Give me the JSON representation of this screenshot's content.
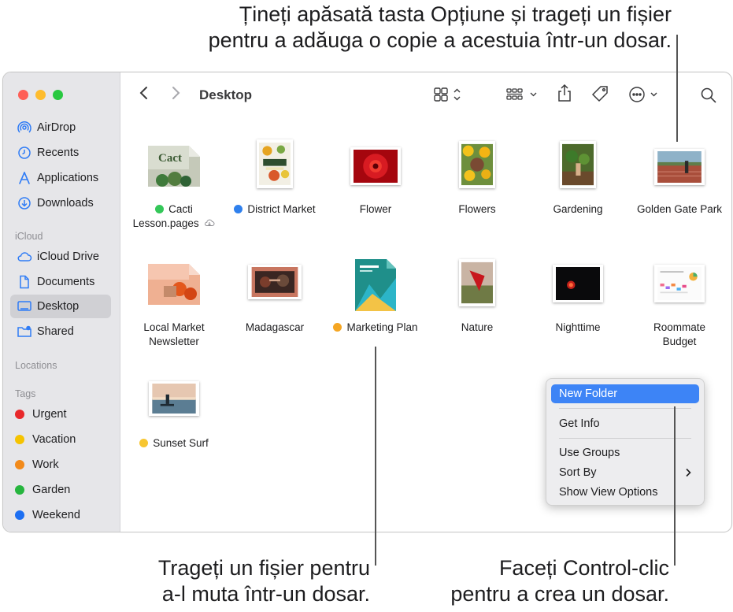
{
  "callouts": {
    "top": [
      "Țineți apăsată tasta Opțiune și trageți un fișier",
      "pentru a adăuga o copie a acestuia într-un dosar."
    ],
    "left": [
      "Trageți un fișier pentru",
      "a-l muta într-un dosar."
    ],
    "right": [
      "Faceți Control-clic",
      "pentru a crea un dosar."
    ]
  },
  "window": {
    "title": "Desktop"
  },
  "sidebar": {
    "favorites": [
      {
        "label": "AirDrop",
        "icon": "airdrop-icon"
      },
      {
        "label": "Recents",
        "icon": "clock-icon"
      },
      {
        "label": "Applications",
        "icon": "applications-icon"
      },
      {
        "label": "Downloads",
        "icon": "download-icon"
      }
    ],
    "icloud_header": "iCloud",
    "icloud": [
      {
        "label": "iCloud Drive",
        "icon": "cloud-icon"
      },
      {
        "label": "Documents",
        "icon": "document-icon"
      },
      {
        "label": "Desktop",
        "icon": "desktop-icon"
      },
      {
        "label": "Shared",
        "icon": "shared-folder-icon"
      }
    ],
    "locations_header": "Locations",
    "tags_header": "Tags",
    "tags": [
      {
        "label": "Urgent",
        "color": "#e8282b"
      },
      {
        "label": "Vacation",
        "color": "#f5c300"
      },
      {
        "label": "Work",
        "color": "#f28a1a"
      },
      {
        "label": "Garden",
        "color": "#26b53e"
      },
      {
        "label": "Weekend",
        "color": "#1d6ff2"
      }
    ]
  },
  "files": [
    {
      "line1": "Cacti",
      "line2": "Lesson.pages",
      "tag_color": "#34c759",
      "thumb": "cacti"
    },
    {
      "line1": "District Market",
      "line2": "",
      "tag_color": "#2f80ed",
      "thumb": "district"
    },
    {
      "line1": "Flower",
      "line2": "",
      "tag_color": "",
      "thumb": "flower"
    },
    {
      "line1": "Flowers",
      "line2": "",
      "tag_color": "",
      "thumb": "flowers"
    },
    {
      "line1": "Gardening",
      "line2": "",
      "tag_color": "",
      "thumb": "gardening"
    },
    {
      "line1": "Golden Gate Park",
      "line2": "",
      "tag_color": "",
      "thumb": "park"
    },
    {
      "line1": "Local Market",
      "line2": "Newsletter",
      "tag_color": "",
      "thumb": "localmarket"
    },
    {
      "line1": "Madagascar",
      "line2": "",
      "tag_color": "",
      "thumb": "madagascar"
    },
    {
      "line1": "Marketing Plan",
      "line2": "",
      "tag_color": "#f5a623",
      "thumb": "marketing"
    },
    {
      "line1": "Nature",
      "line2": "",
      "tag_color": "",
      "thumb": "nature"
    },
    {
      "line1": "Nighttime",
      "line2": "",
      "tag_color": "",
      "thumb": "night"
    },
    {
      "line1": "Roommate",
      "line2": "Budget",
      "tag_color": "",
      "thumb": "budget"
    },
    {
      "line1": "Sunset Surf",
      "line2": "",
      "tag_color": "#f7c631",
      "thumb": "surf"
    }
  ],
  "context_menu": {
    "new_folder": "New Folder",
    "get_info": "Get Info",
    "use_groups": "Use Groups",
    "sort_by": "Sort By",
    "show_view_options": "Show View Options"
  }
}
